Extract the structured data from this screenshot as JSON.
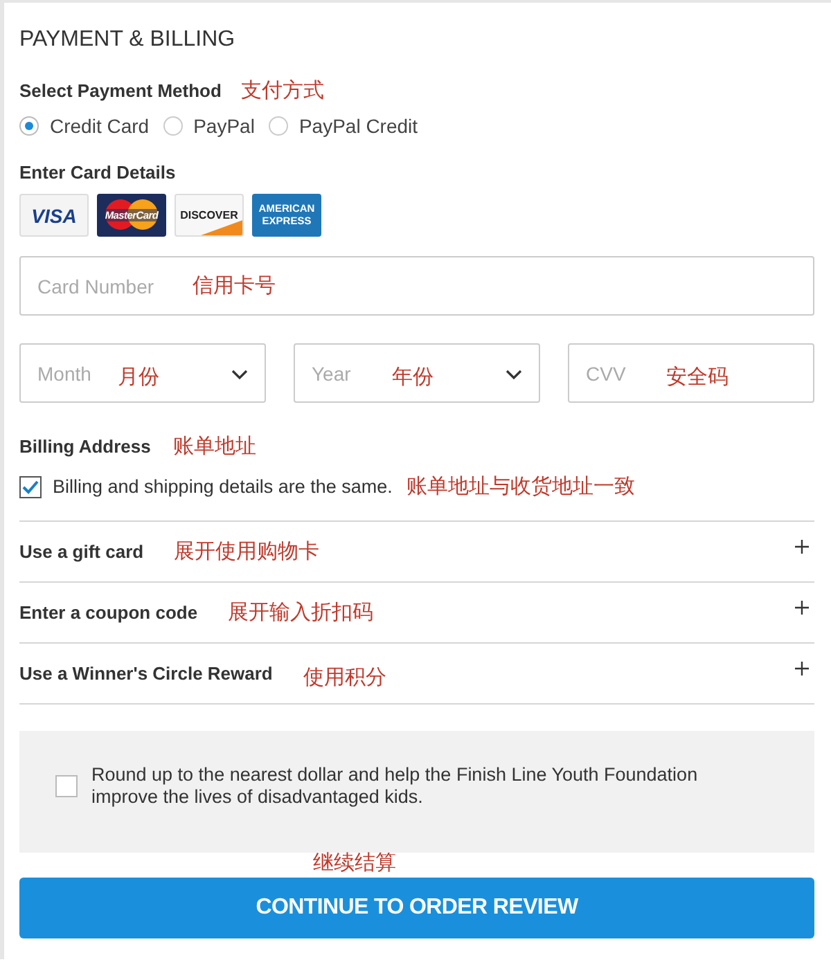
{
  "section_title": "PAYMENT & BILLING",
  "payment_method": {
    "label": "Select Payment Method",
    "note": "支付方式",
    "options": [
      {
        "label": "Credit Card",
        "selected": true
      },
      {
        "label": "PayPal",
        "selected": false
      },
      {
        "label": "PayPal Credit",
        "selected": false
      }
    ]
  },
  "card_details": {
    "label": "Enter Card Details",
    "card_logos": [
      {
        "kind": "visa",
        "text": "VISA"
      },
      {
        "kind": "mastercard",
        "text": "MasterCard"
      },
      {
        "kind": "discover",
        "text": "DISCOVER"
      },
      {
        "kind": "amex",
        "text": "AMERICAN EXPRESS"
      }
    ]
  },
  "card_number": {
    "placeholder": "Card Number",
    "note": "信用卡号"
  },
  "expiry_fields": [
    {
      "kind": "select",
      "placeholder": "Month",
      "note": "月份"
    },
    {
      "kind": "select",
      "placeholder": "Year",
      "note": "年份"
    },
    {
      "kind": "input",
      "placeholder": "CVV",
      "note": "安全码"
    }
  ],
  "billing": {
    "label": "Billing Address",
    "note": "账单地址",
    "same_as_shipping": {
      "label": "Billing and shipping details are the same.",
      "checked": true,
      "note": "账单地址与收货地址一致"
    }
  },
  "expanders": [
    {
      "label": "Use a gift card",
      "note": "展开使用购物卡",
      "expanded": false
    },
    {
      "label": "Enter a coupon code",
      "note": "展开输入折扣码",
      "expanded": false
    },
    {
      "label": "Use a Winner's Circle Reward",
      "note": "使用积分",
      "expanded": false
    }
  ],
  "donation": {
    "label": "Round up to the nearest dollar and help the Finish Line Youth Foundation improve the lives of disadvantaged kids.",
    "checked": false
  },
  "button_note": "继续结算",
  "button": "CONTINUE TO ORDER REVIEW"
}
